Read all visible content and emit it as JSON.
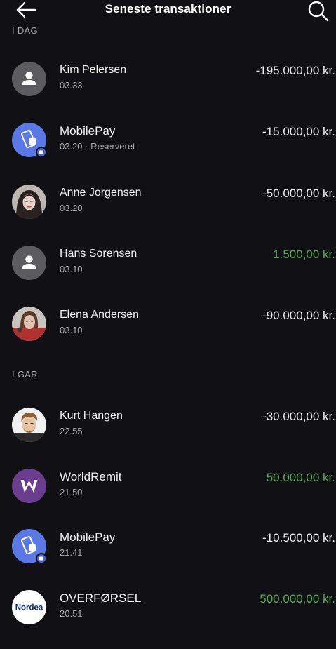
{
  "header": {
    "title": "Seneste transaktioner",
    "back_icon": "arrow-left-icon",
    "search_icon": "search-icon"
  },
  "sections": [
    {
      "label": "I DAG",
      "transactions": [
        {
          "name": "Kim Pelersen",
          "time": "03.33",
          "amount": "-195.000,00 kr.",
          "avatar": "person-placeholder-icon"
        },
        {
          "name": "MobilePay",
          "time": "03.20 · Reserveret",
          "amount": "-15.000,00 kr.",
          "avatar": "mobilepay-logo"
        },
        {
          "name": "Anne Jorgensen",
          "time": "03.20",
          "amount": "-50.000,00 kr.",
          "avatar": "photo-avatar"
        },
        {
          "name": "Hans Sorensen",
          "time": "03.10",
          "amount": "1.500,00 kr.",
          "avatar": "person-placeholder-icon"
        },
        {
          "name": "Elena Andersen",
          "time": "03.10",
          "amount": "-90.000,00 kr.",
          "avatar": "photo-avatar"
        }
      ]
    },
    {
      "label": "I GAR",
      "transactions": [
        {
          "name": "Kurt Hangen",
          "time": "22.55",
          "amount": "-30.000,00 kr.",
          "avatar": "photo-avatar"
        },
        {
          "name": "WorldRemit",
          "time": "21.50",
          "amount": "50.000,00 kr.",
          "avatar": "worldremit-logo"
        },
        {
          "name": "MobilePay",
          "time": "21.41",
          "amount": "-10.500,00 kr.",
          "avatar": "mobilepay-logo"
        },
        {
          "name": "OVERFØRSEL",
          "time": "20.51",
          "amount": "500.000,00 kr.",
          "avatar": "nordea-logo",
          "logo_text": "Nordea"
        }
      ]
    }
  ],
  "colors": {
    "background": "#111115",
    "positive_amount": "#58a855",
    "mobilepay_blue": "#5a78e6",
    "worldremit_purple": "#6a3d8f",
    "nordea_blue": "#0b2a8a"
  }
}
